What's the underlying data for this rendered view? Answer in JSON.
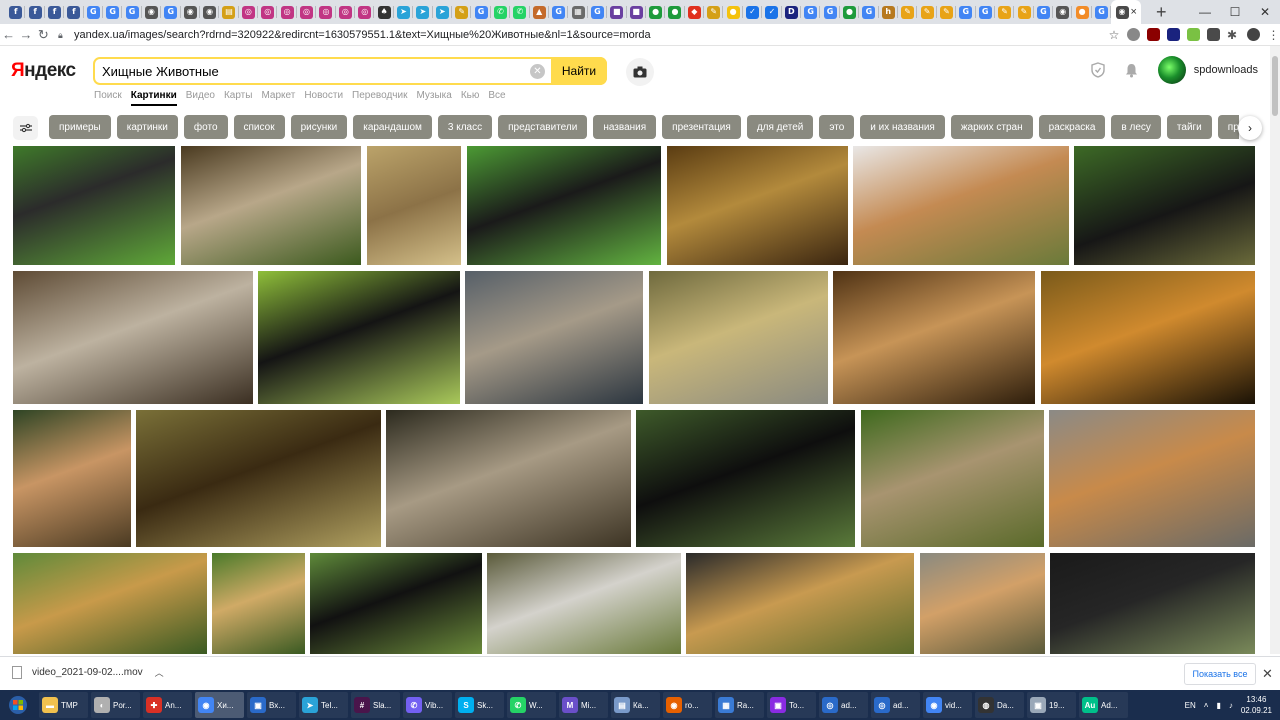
{
  "browser": {
    "tab_favicons": [
      {
        "icon": "facebook-icon",
        "color": "#3b5998",
        "glyph": "f"
      },
      {
        "icon": "facebook-icon",
        "color": "#3b5998",
        "glyph": "f"
      },
      {
        "icon": "facebook-icon",
        "color": "#3b5998",
        "glyph": "f"
      },
      {
        "icon": "facebook-icon",
        "color": "#3b5998",
        "glyph": "f"
      },
      {
        "icon": "google-icon",
        "color": "#4285f4",
        "glyph": "G"
      },
      {
        "icon": "google-icon",
        "color": "#4285f4",
        "glyph": "G"
      },
      {
        "icon": "google-icon",
        "color": "#4285f4",
        "glyph": "G"
      },
      {
        "icon": "globe-icon",
        "color": "#555555",
        "glyph": "◉"
      },
      {
        "icon": "google-icon",
        "color": "#4285f4",
        "glyph": "G"
      },
      {
        "icon": "globe-icon",
        "color": "#555555",
        "glyph": "◉"
      },
      {
        "icon": "globe-icon",
        "color": "#555555",
        "glyph": "◉"
      },
      {
        "icon": "news-icon",
        "color": "#d4a017",
        "glyph": "▤"
      },
      {
        "icon": "instagram-icon",
        "color": "#c13584",
        "glyph": "◎"
      },
      {
        "icon": "instagram-icon",
        "color": "#c13584",
        "glyph": "◎"
      },
      {
        "icon": "instagram-icon",
        "color": "#c13584",
        "glyph": "◎"
      },
      {
        "icon": "instagram-icon",
        "color": "#c13584",
        "glyph": "◎"
      },
      {
        "icon": "instagram-icon",
        "color": "#c13584",
        "glyph": "◎"
      },
      {
        "icon": "instagram-icon",
        "color": "#c13584",
        "glyph": "◎"
      },
      {
        "icon": "instagram-icon",
        "color": "#c13584",
        "glyph": "◎"
      },
      {
        "icon": "fire-icon",
        "color": "#333333",
        "glyph": "♠"
      },
      {
        "icon": "telegram-icon",
        "color": "#2aa3d8",
        "glyph": "➤"
      },
      {
        "icon": "telegram-icon",
        "color": "#2aa3d8",
        "glyph": "➤"
      },
      {
        "icon": "telegram-icon",
        "color": "#2aa3d8",
        "glyph": "➤"
      },
      {
        "icon": "tool-icon",
        "color": "#d4a017",
        "glyph": "✎"
      },
      {
        "icon": "google-icon",
        "color": "#4285f4",
        "glyph": "G"
      },
      {
        "icon": "whatsapp-icon",
        "color": "#25d366",
        "glyph": "✆"
      },
      {
        "icon": "whatsapp-icon",
        "color": "#25d366",
        "glyph": "✆"
      },
      {
        "icon": "bottle-icon",
        "color": "#c46a2b",
        "glyph": "▲"
      },
      {
        "icon": "google-icon",
        "color": "#4285f4",
        "glyph": "G"
      },
      {
        "icon": "doc-icon",
        "color": "#6a6a6a",
        "glyph": "▦"
      },
      {
        "icon": "google-icon",
        "color": "#4285f4",
        "glyph": "G"
      },
      {
        "icon": "square-icon",
        "color": "#6a3fa0",
        "glyph": "■"
      },
      {
        "icon": "square-icon",
        "color": "#6a3fa0",
        "glyph": "■"
      },
      {
        "icon": "green-circle-icon",
        "color": "#1e9b3c",
        "glyph": "●"
      },
      {
        "icon": "green-circle-icon",
        "color": "#1e9b3c",
        "glyph": "●"
      },
      {
        "icon": "red-icon",
        "color": "#e0301e",
        "glyph": "◆"
      },
      {
        "icon": "tool-icon",
        "color": "#d4a017",
        "glyph": "✎"
      },
      {
        "icon": "yellow-circle-icon",
        "color": "#f4c20d",
        "glyph": "●"
      },
      {
        "icon": "check-icon",
        "color": "#1a73e8",
        "glyph": "✓"
      },
      {
        "icon": "check-icon",
        "color": "#1a73e8",
        "glyph": "✓"
      },
      {
        "icon": "d-icon",
        "color": "#1a237e",
        "glyph": "D"
      },
      {
        "icon": "google-icon",
        "color": "#4285f4",
        "glyph": "G"
      },
      {
        "icon": "google-icon",
        "color": "#4285f4",
        "glyph": "G"
      },
      {
        "icon": "green-circle-icon",
        "color": "#1e9b3c",
        "glyph": "●"
      },
      {
        "icon": "google-icon",
        "color": "#4285f4",
        "glyph": "G"
      },
      {
        "icon": "h-icon",
        "color": "#b7791f",
        "glyph": "h"
      },
      {
        "icon": "tool-icon",
        "color": "#e8a317",
        "glyph": "✎"
      },
      {
        "icon": "tool-icon",
        "color": "#e8a317",
        "glyph": "✎"
      },
      {
        "icon": "tool-icon",
        "color": "#e8a317",
        "glyph": "✎"
      },
      {
        "icon": "google-icon",
        "color": "#4285f4",
        "glyph": "G"
      },
      {
        "icon": "google-icon",
        "color": "#4285f4",
        "glyph": "G"
      },
      {
        "icon": "tool-icon",
        "color": "#e8a317",
        "glyph": "✎"
      },
      {
        "icon": "tool-icon",
        "color": "#e8a317",
        "glyph": "✎"
      },
      {
        "icon": "google-icon",
        "color": "#4285f4",
        "glyph": "G"
      },
      {
        "icon": "globe-icon",
        "color": "#555555",
        "glyph": "◉"
      },
      {
        "icon": "orange-icon",
        "color": "#f28c28",
        "glyph": "●"
      },
      {
        "icon": "google-icon",
        "color": "#4285f4",
        "glyph": "G"
      }
    ],
    "active_tab_close": "×",
    "new_tab": "+",
    "url": "yandex.ua/images/search?rdrnd=320922&redircnt=1630579551.1&text=Хищные%20Животные&nl=1&source=morda"
  },
  "yandex": {
    "logo_first": "Я",
    "logo_rest": "ндекс",
    "search_value": "Хищные Животные",
    "search_button": "Найти",
    "services": [
      "Поиск",
      "Картинки",
      "Видео",
      "Карты",
      "Маркет",
      "Новости",
      "Переводчик",
      "Музыка",
      "Кью",
      "Все"
    ],
    "username": "spdownloads"
  },
  "tags": [
    "примеры",
    "картинки",
    "фото",
    "список",
    "рисунки",
    "карандашом",
    "3 класс",
    "представители",
    "названия",
    "презентация",
    "для детей",
    "это",
    "и их названия",
    "жарких стран",
    "раскраска",
    "в лесу",
    "тайги",
    "представители"
  ],
  "images": [
    [
      {
        "bg": "linear-gradient(160deg,#3f7a2a 0%,#2b2b2b 40%,#5fa838 100%)"
      },
      {
        "bg": "linear-gradient(160deg,#4a3a20 0%,#b8a789 45%,#3c5a1e 100%)"
      },
      {
        "bg": "linear-gradient(160deg,#bba36a 0%,#8c7247 50%,#d4c08a 100%)"
      },
      {
        "bg": "linear-gradient(160deg,#4c9a34 0%,#1a1a1a 45%,#62b340 100%)"
      },
      {
        "bg": "linear-gradient(160deg,#5a3c12 0%,#b38a3c 45%,#3a2510 100%)"
      },
      {
        "bg": "linear-gradient(160deg,#e9e7e6 0%,#c48a52 45%,#6a7a3a 100%)"
      },
      {
        "bg": "linear-gradient(160deg,#3d6a26 0%,#161616 55%,#6a6a3a 100%)"
      }
    ],
    [
      {
        "bg": "linear-gradient(160deg,#5e4b35 0%,#bdb2a0 45%,#3b2f22 100%)"
      },
      {
        "bg": "linear-gradient(160deg,#8fbf3a 0%,#141414 45%,#a9c95a 100%)"
      },
      {
        "bg": "linear-gradient(160deg,#565f68 0%,#a59a88 45%,#2c3640 100%)"
      },
      {
        "bg": "linear-gradient(160deg,#6f6a3e 0%,#c9b77a 45%,#8a8a80 100%)"
      },
      {
        "bg": "linear-gradient(160deg,#4f3214 0%,#c79457 45%,#2e1e0c 100%)"
      },
      {
        "bg": "linear-gradient(160deg,#7a5a1a 0%,#d08a2e 45%,#1a1206 100%)"
      }
    ],
    [
      {
        "bg": "linear-gradient(160deg,#2e4424 0%,#c89564 45%,#4a3a22 100%)"
      },
      {
        "bg": "linear-gradient(160deg,#7a7038 0%,#3a2a12 45%,#b0a060 100%)"
      },
      {
        "bg": "linear-gradient(160deg,#2c2a1e 0%,#a79a84 45%,#3d3424 100%)"
      },
      {
        "bg": "linear-gradient(160deg,#3e5a2a 0%,#0e0e0e 45%,#5a7a3a 100%)"
      },
      {
        "bg": "linear-gradient(160deg,#3f6a1e 0%,#a89470 45%,#5a6a2a 100%)"
      },
      {
        "bg": "linear-gradient(160deg,#8b8a86 0%,#c88a4a 45%,#6a6a66 100%)"
      }
    ],
    [
      {
        "bg": "linear-gradient(160deg,#5f8a3a 0%,#c89a4a 45%,#3a5a22 100%)"
      },
      {
        "bg": "linear-gradient(160deg,#4a7a2a 0%,#d0aa66 45%,#3a5a22 100%)"
      },
      {
        "bg": "linear-gradient(160deg,#5f8a3a 0%,#111111 45%,#6a8a3a 100%)"
      },
      {
        "bg": "linear-gradient(160deg,#5a5a3a 0%,#d4d2cc 45%,#6a7a3a 100%)"
      },
      {
        "bg": "linear-gradient(160deg,#2a2a2a 0%,#c89a50 45%,#5a6a2a 100%)"
      },
      {
        "bg": "linear-gradient(160deg,#8a8a80 0%,#d2a068 45%,#5a5a3a 100%)"
      },
      {
        "bg": "linear-gradient(160deg,#1a1a1a 0%,#262626 45%,#7a8a5a 100%)"
      }
    ]
  ],
  "downloads": {
    "filename": "video_2021-09-02....mov",
    "show_all": "Показать все"
  },
  "taskbar": {
    "items": [
      {
        "icon": "folder-icon",
        "color": "#f2c14e",
        "glyph": "▬",
        "label": "TMP"
      },
      {
        "icon": "app-icon",
        "color": "#b0b0b0",
        "glyph": "◐",
        "label": "Por..."
      },
      {
        "icon": "plus-icon",
        "color": "#d93025",
        "glyph": "✚",
        "label": "An..."
      },
      {
        "icon": "chrome-icon",
        "color": "#4285f4",
        "glyph": "◉",
        "label": "Хи..."
      },
      {
        "icon": "app-icon",
        "color": "#2a6ac9",
        "glyph": "▣",
        "label": "Вх..."
      },
      {
        "icon": "telegram-icon",
        "color": "#2aa3d8",
        "glyph": "➤",
        "label": "Tel..."
      },
      {
        "icon": "slack-icon",
        "color": "#4a154b",
        "glyph": "#",
        "label": "Sla..."
      },
      {
        "icon": "viber-icon",
        "color": "#7360f2",
        "glyph": "✆",
        "label": "Vib..."
      },
      {
        "icon": "skype-icon",
        "color": "#00aff0",
        "glyph": "S",
        "label": "Sk..."
      },
      {
        "icon": "whatsapp-icon",
        "color": "#25d366",
        "glyph": "✆",
        "label": "W..."
      },
      {
        "icon": "app-icon",
        "color": "#6a4fc9",
        "glyph": "M",
        "label": "Mi..."
      },
      {
        "icon": "notepad-icon",
        "color": "#7a9ac9",
        "glyph": "▤",
        "label": "Ка..."
      },
      {
        "icon": "firefox-icon",
        "color": "#e66000",
        "glyph": "◉",
        "label": "ro..."
      },
      {
        "icon": "windows-icon",
        "color": "#3a7bd5",
        "glyph": "▦",
        "label": "Ra..."
      },
      {
        "icon": "floppy-icon",
        "color": "#8a2be2",
        "glyph": "▣",
        "label": "To..."
      },
      {
        "icon": "app-icon",
        "color": "#2a6ac9",
        "glyph": "◎",
        "label": "ad..."
      },
      {
        "icon": "app-icon",
        "color": "#2a6ac9",
        "glyph": "◎",
        "label": "ad..."
      },
      {
        "icon": "chrome-icon",
        "color": "#4285f4",
        "glyph": "◉",
        "label": "vid..."
      },
      {
        "icon": "lock-icon",
        "color": "#333333",
        "glyph": "◍",
        "label": "Da..."
      },
      {
        "icon": "network-icon",
        "color": "#9aa8b8",
        "glyph": "▣",
        "label": "19..."
      },
      {
        "icon": "audition-icon",
        "color": "#00c08a",
        "glyph": "Au",
        "label": "Ad..."
      }
    ],
    "lang": "EN",
    "time": "13:46",
    "date": "02.09.21"
  }
}
